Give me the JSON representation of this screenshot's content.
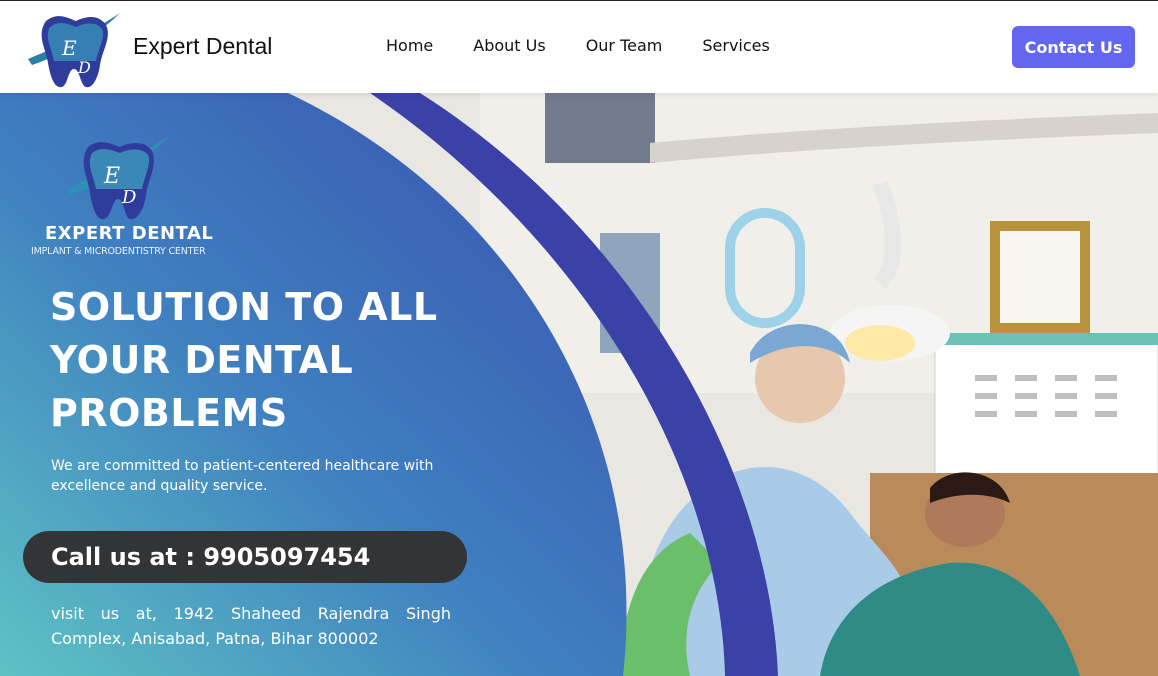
{
  "header": {
    "brand": "Expert Dental",
    "nav": [
      {
        "label": "Home"
      },
      {
        "label": "About Us"
      },
      {
        "label": "Our Team"
      },
      {
        "label": "Services"
      }
    ],
    "cta_label": "Contact Us"
  },
  "hero": {
    "brand": "EXPERT DENTAL",
    "tagline": "IMPLANT & MICRODENTISTRY CENTER",
    "headline_lines": [
      "SOLUTION TO ALL",
      "YOUR DENTAL",
      "PROBLEMS"
    ],
    "subtext": "We are committed to patient-centered healthcare with excellence and quality service.",
    "call_text": "Call us at : 9905097454",
    "address": "visit us at, 1942 Shaheed Rajendra Singh Complex, Anisabad, Patna, Bihar 800002"
  },
  "colors": {
    "accent": "#6366f1",
    "panel_teal": "#5ec3c4",
    "panel_blue": "#3a4fae",
    "arc": "#3a42a8",
    "pill": "#333436"
  },
  "icons": {
    "logo": "tooth-logo-icon",
    "hero_logo": "tooth-logo-icon"
  }
}
